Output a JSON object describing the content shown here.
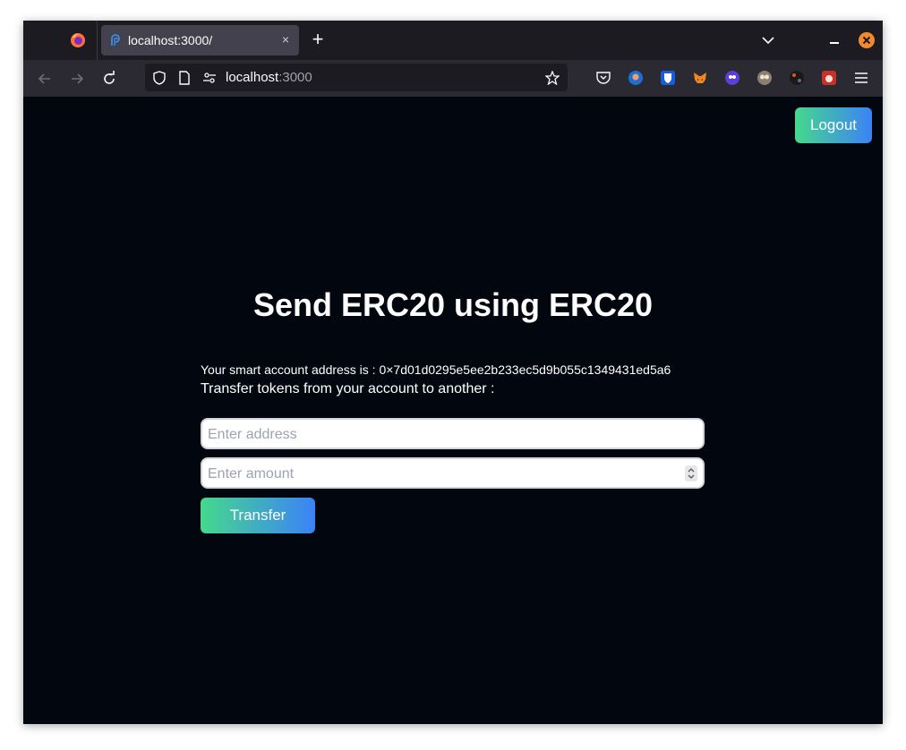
{
  "browser": {
    "tab_title": "localhost:3000/",
    "url_host": "localhost",
    "url_port": ":3000",
    "new_tab_label": "+",
    "close_tab_label": "×"
  },
  "page": {
    "logout_label": "Logout",
    "heading": "Send ERC20 using ERC20",
    "address_line": "Your smart account address is : 0×7d01d0295e5ee2b233ec5d9b055c1349431ed5a6",
    "transfer_line": "Transfer tokens from your account to another :",
    "address_placeholder": "Enter address",
    "amount_placeholder": "Enter amount",
    "transfer_label": "Transfer"
  },
  "colors": {
    "page_background": "#02060f",
    "gradient_start": "#46d88d",
    "gradient_end": "#3b82f6",
    "browser_chrome": "#2b2a33"
  }
}
